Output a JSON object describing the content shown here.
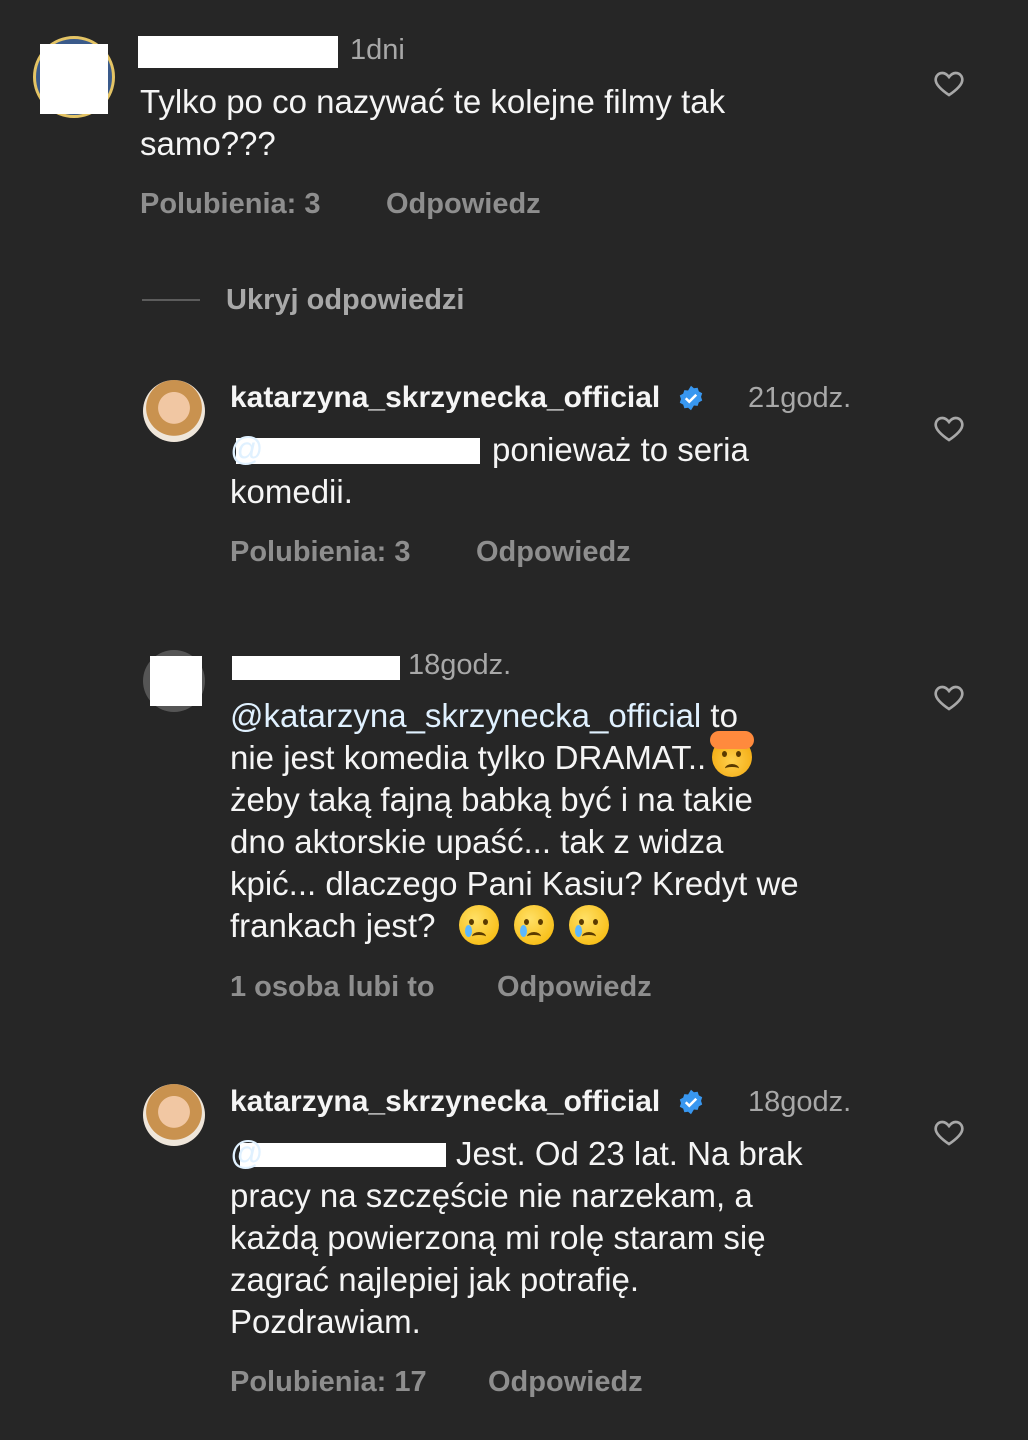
{
  "comments": [
    {
      "time": "1dni",
      "text": "Tylko po co nazywać te kolejne filmy tak samo???",
      "likes": "Polubienia: 3",
      "reply": "Odpowiedz"
    },
    {
      "hide_replies": "Ukryj odpowiedzi"
    },
    {
      "username": "katarzyna_skrzynecka_official",
      "time": "21godz.",
      "text_after_mention": "ponieważ to seria",
      "text_line2": "komedii.",
      "likes": "Polubienia: 3",
      "reply": "Odpowiedz"
    },
    {
      "time": "18godz.",
      "mention": "@katarzyna_skrzynecka_official",
      "line1_rest": " to",
      "line2": "nie jest komedia tylko DRAMAT..",
      "line3": "żeby taką fajną babką być i na takie",
      "line4": "dno aktorskie upaść... tak z widza",
      "line5": "kpić... dlaczego Pani Kasiu? Kredyt we",
      "line6": "frankach jest?",
      "likes": "1 osoba lubi to",
      "reply": "Odpowiedz"
    },
    {
      "username": "katarzyna_skrzynecka_official",
      "time": "18godz.",
      "text_after_mention": "Jest. Od 23 lat. Na brak",
      "line2": "pracy na szczęście nie narzekam, a",
      "line3": "każdą powierzoną mi rolę staram się",
      "line4": "zagrać najlepiej jak potrafię.",
      "line5": "Pozdrawiam.",
      "likes": "Polubienia: 17",
      "reply": "Odpowiedz"
    }
  ],
  "colors": {
    "background": "#262626",
    "text": "#f5f5f5",
    "secondary": "#8e8e8e",
    "verified": "#3897f0"
  }
}
